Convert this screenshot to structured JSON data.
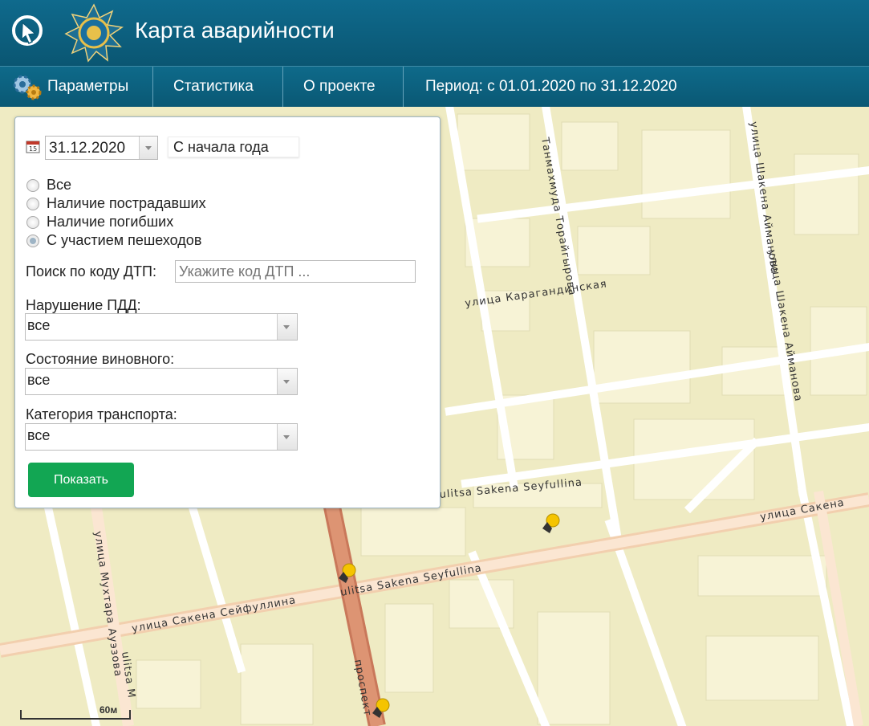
{
  "app": {
    "title": "Карта аварийности",
    "logo_icon": "cursor-globe-icon",
    "emblem_icon": "kz-emblem-icon"
  },
  "nav": {
    "params": "Параметры",
    "stats": "Статистика",
    "about": "О проекте",
    "period": "Период: с 01.01.2020 по 31.12.2020"
  },
  "filter": {
    "date": "31.12.2020",
    "period_button": "С начала года",
    "radios": [
      {
        "label": "Все",
        "selected": false
      },
      {
        "label": "Наличие пострадавших",
        "selected": false
      },
      {
        "label": "Наличие погибших",
        "selected": false
      },
      {
        "label": "С участием пешеходов",
        "selected": true
      }
    ],
    "search_label": "Поиск по коду ДТП:",
    "search_placeholder": "Укажите код ДТП ...",
    "violation_label": "Нарушение ПДД:",
    "violation_value": "все",
    "culprit_label": "Состояние виновного:",
    "culprit_value": "все",
    "transport_label": "Категория транспорта:",
    "transport_value": "все",
    "show_button": "Показать"
  },
  "map": {
    "streets": {
      "tanmamud": "Танмахмуда Торайгырова",
      "karagandy": "улица Карагандинская",
      "aymanov_top": "улица Шакена Айманова",
      "aymanova": "улица Шакена Айманова",
      "sakena_right": "улица Сакена",
      "seyfullina_mid": "ulitsa Sakena Seyfullina",
      "seyfullina_top": "ulitsa Sakena Seyfullina",
      "seyfullina_left": "улица Сакена Сейфуллина",
      "auezova": "улица Мухтара Ауэзова",
      "auezova_latin": "ulitsa M",
      "prospekt": "проспект",
      "aymanova_vert": "улица Шакена Айманова"
    },
    "scale_label": "60м",
    "colors": {
      "land": "#efebc3",
      "road": "#ffffff",
      "main_road": "#d98e6a",
      "block": "#f8f5dc"
    }
  }
}
